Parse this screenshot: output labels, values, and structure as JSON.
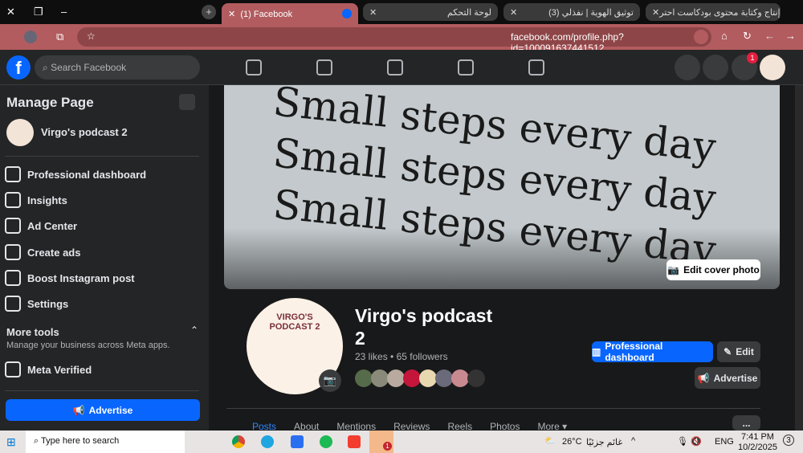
{
  "browser": {
    "tabs": [
      {
        "label": "(1) Facebook",
        "active": true
      },
      {
        "label": "لوحة التحكم"
      },
      {
        "label": "(3) توثيق الهوية | نفذلي"
      },
      {
        "label": "إنتاج وكتابة محتوى بودكاست احتر"
      }
    ],
    "url": "facebook.com/profile.php?id=100091637441512"
  },
  "fb": {
    "search_placeholder": "Search Facebook",
    "notif_count": "1"
  },
  "sidebar": {
    "title": "Manage Page",
    "page_name": "Virgo's podcast 2",
    "items": [
      {
        "label": "Professional dashboard"
      },
      {
        "label": "Insights"
      },
      {
        "label": "Ad Center"
      },
      {
        "label": "Create ads"
      },
      {
        "label": "Boost Instagram post"
      },
      {
        "label": "Settings"
      }
    ],
    "more_tools": "More tools",
    "more_tools_sub": "Manage your business across Meta apps.",
    "meta_verified": "Meta Verified",
    "advertise": "Advertise"
  },
  "cover": {
    "text": "Small steps every day",
    "edit_label": "Edit cover photo"
  },
  "profile": {
    "name": "Virgo's podcast 2",
    "likes": "23 likes",
    "followers": "65 followers",
    "avatar_title": "VIRGO'S PODCAST 2",
    "pro_dashboard": "Professional dashboard",
    "edit": "Edit",
    "advertise": "Advertise"
  },
  "tabs": [
    "Posts",
    "About",
    "Mentions",
    "Reviews",
    "Reels",
    "Photos",
    "More"
  ],
  "more_menu": "...",
  "taskbar": {
    "search": "Type here to search",
    "weather": "26°C",
    "weather_text": "غائم جزئيًا",
    "lang": "ENG",
    "time": "7:41 PM",
    "date": "10/2/2025",
    "notif": "3",
    "teams_badge": "1"
  },
  "colors": {
    "accent": "#0866ff",
    "browser": "#b25c5f"
  }
}
